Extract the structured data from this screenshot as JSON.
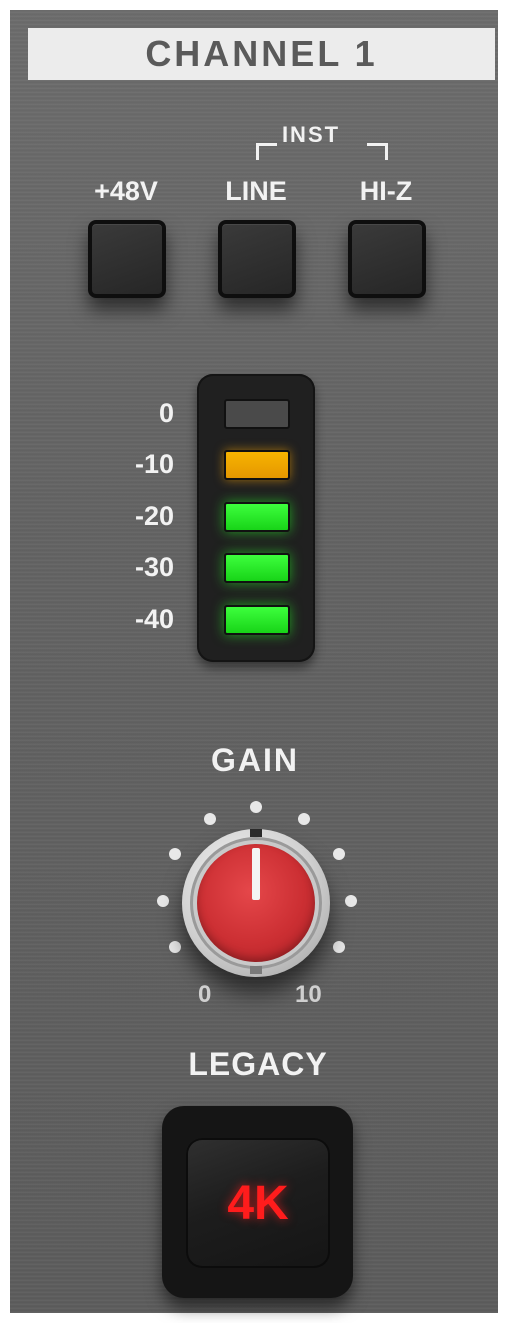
{
  "channel": {
    "title": "CHANNEL 1"
  },
  "input_buttons": {
    "phantom_label": "+48V",
    "line_label": "LINE",
    "hiz_label": "HI-Z",
    "inst_group_label": "INST"
  },
  "meter": {
    "labels": [
      "0",
      "-10",
      "-20",
      "-30",
      "-40"
    ],
    "states": [
      "off",
      "amber",
      "green",
      "green",
      "green"
    ],
    "colors": {
      "amber": "#f0a500",
      "green": "#22ee22",
      "off": "#4a4a4a"
    }
  },
  "gain": {
    "label": "GAIN",
    "scale_min": "0",
    "scale_max": "10",
    "value_fraction": 0.5,
    "accent": "#cc2f33"
  },
  "legacy": {
    "label": "LEGACY",
    "button_text": "4K",
    "text_color": "#ff1c1c"
  }
}
